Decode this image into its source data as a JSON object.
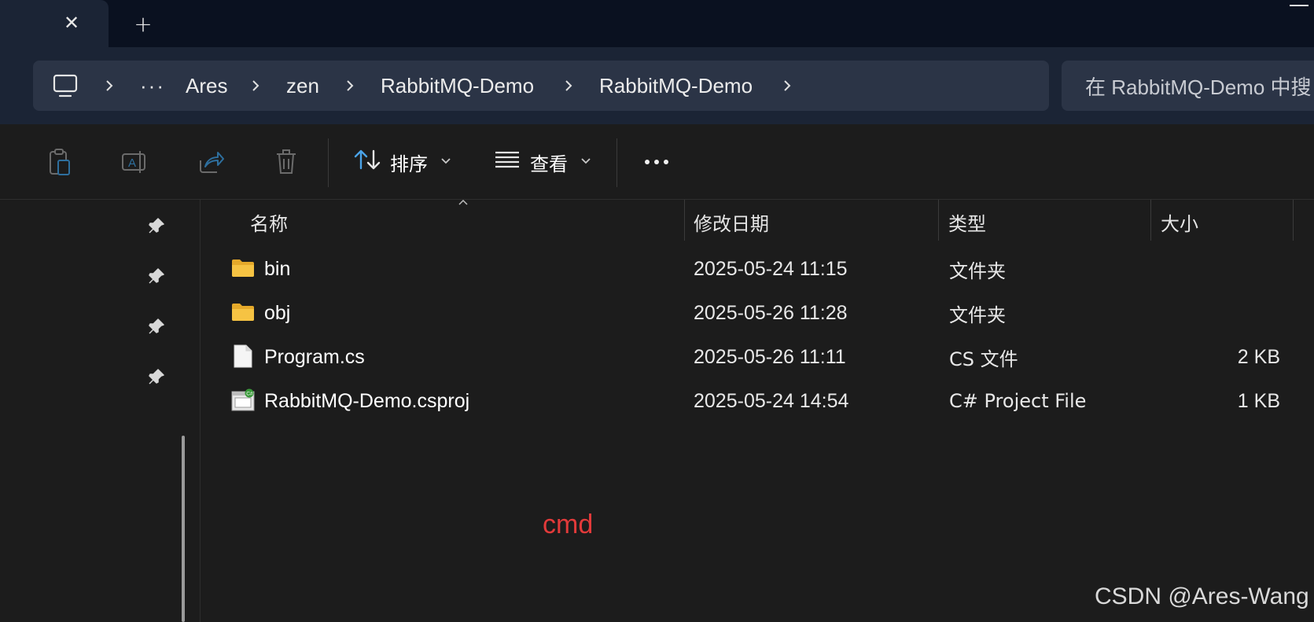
{
  "colors": {
    "tabstrip_bg": "#0a1120",
    "chrome_bg": "#1b2435",
    "addressbar_bg": "#2b3446",
    "content_bg": "#1c1c1c",
    "folder_yellow": "#f6c343",
    "accent_blue": "#4aa3e8",
    "annotation_red": "#e23a3a"
  },
  "tabs": {
    "close_glyph": "✕",
    "new_tab_glyph": "+"
  },
  "address_bar": {
    "root_icon": "computer-icon",
    "overflow": "···",
    "breadcrumbs": [
      "Ares",
      "zen",
      "RabbitMQ-Demo",
      "RabbitMQ-Demo"
    ],
    "separator_icon": "chevron-right-icon"
  },
  "search": {
    "placeholder": "在 RabbitMQ-Demo 中搜"
  },
  "toolbar": {
    "icons": [
      "paste-icon",
      "rename-icon",
      "share-icon",
      "delete-icon"
    ],
    "sort_label": "排序",
    "sort_icon": "sort-arrows-icon",
    "view_label": "查看",
    "view_icon": "view-lines-icon",
    "more_icon": "more-icon"
  },
  "columns": {
    "name": "名称",
    "modified": "修改日期",
    "type": "类型",
    "size": "大小"
  },
  "files": [
    {
      "name": "bin",
      "modified": "2025-05-24 11:15",
      "type": "文件夹",
      "size": "",
      "icon": "folder-icon"
    },
    {
      "name": "obj",
      "modified": "2025-05-26 11:28",
      "type": "文件夹",
      "size": "",
      "icon": "folder-icon"
    },
    {
      "name": "Program.cs",
      "modified": "2025-05-26 11:11",
      "type": "CS 文件",
      "size": "2 KB",
      "icon": "file-icon"
    },
    {
      "name": "RabbitMQ-Demo.csproj",
      "modified": "2025-05-24 14:54",
      "type": "C# Project File",
      "size": "1 KB",
      "icon": "csproj-icon"
    }
  ],
  "annotation": {
    "text": "cmd"
  },
  "watermark": {
    "text": "CSDN @Ares-Wang"
  }
}
